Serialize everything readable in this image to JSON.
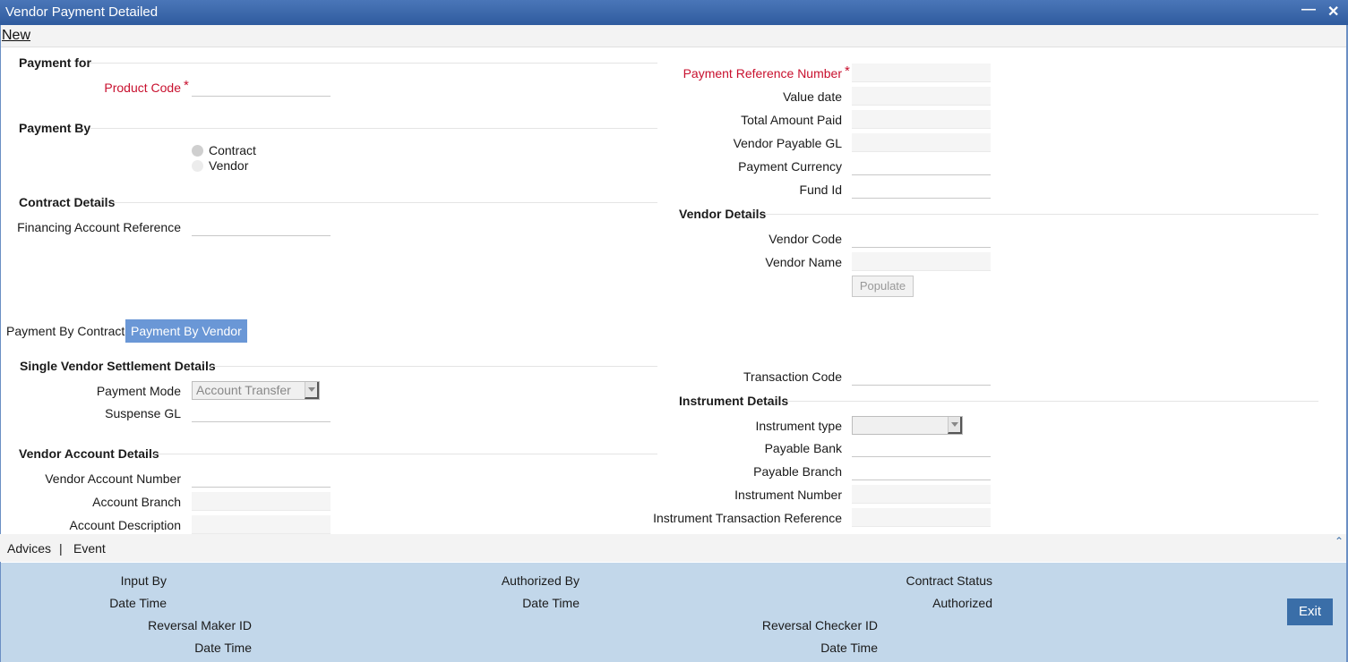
{
  "window": {
    "title": "Vendor Payment Detailed"
  },
  "menu": {
    "new_label": "New"
  },
  "payment_for": {
    "section": "Payment for",
    "product_code_label": "Product Code",
    "required_mark": "*"
  },
  "payment_by": {
    "section": "Payment By",
    "options": [
      "Contract",
      "Vendor"
    ]
  },
  "contract_details": {
    "section": "Contract Details",
    "financing_account_reference_label": "Financing Account Reference"
  },
  "right_fields": {
    "payment_reference_number_label": "Payment Reference Number",
    "value_date_label": "Value date",
    "total_amount_paid_label": "Total Amount Paid",
    "vendor_payable_gl_label": "Vendor Payable GL",
    "payment_currency_label": "Payment Currency",
    "fund_id_label": "Fund Id"
  },
  "vendor_details": {
    "section": "Vendor Details",
    "vendor_code_label": "Vendor Code",
    "vendor_name_label": "Vendor Name",
    "populate_label": "Populate"
  },
  "tabs": [
    {
      "label": "Payment By Contract",
      "active": false
    },
    {
      "label": "Payment By Vendor",
      "active": true
    }
  ],
  "settlement": {
    "section": "Single Vendor Settlement Details",
    "payment_mode_label": "Payment Mode",
    "payment_mode_value": "Account Transfer",
    "suspense_gl_label": "Suspense GL",
    "transaction_code_label": "Transaction Code"
  },
  "vendor_account": {
    "section": "Vendor Account Details",
    "account_number_label": "Vendor Account Number",
    "account_branch_label": "Account Branch",
    "account_description_label": "Account Description"
  },
  "instrument": {
    "section": "Instrument Details",
    "type_label": "Instrument type",
    "payable_bank_label": "Payable Bank",
    "payable_branch_label": "Payable Branch",
    "number_label": "Instrument Number",
    "transaction_reference_label": "Instrument Transaction Reference"
  },
  "links": {
    "advices": "Advices",
    "separator": "|",
    "event": "Event"
  },
  "footer": {
    "input_by": "Input By",
    "date_time": "Date Time",
    "reversal_maker_id": "Reversal Maker ID",
    "authorized_by": "Authorized By",
    "reversal_checker_id": "Reversal Checker ID",
    "contract_status": "Contract Status",
    "authorized": "Authorized",
    "exit_label": "Exit"
  }
}
